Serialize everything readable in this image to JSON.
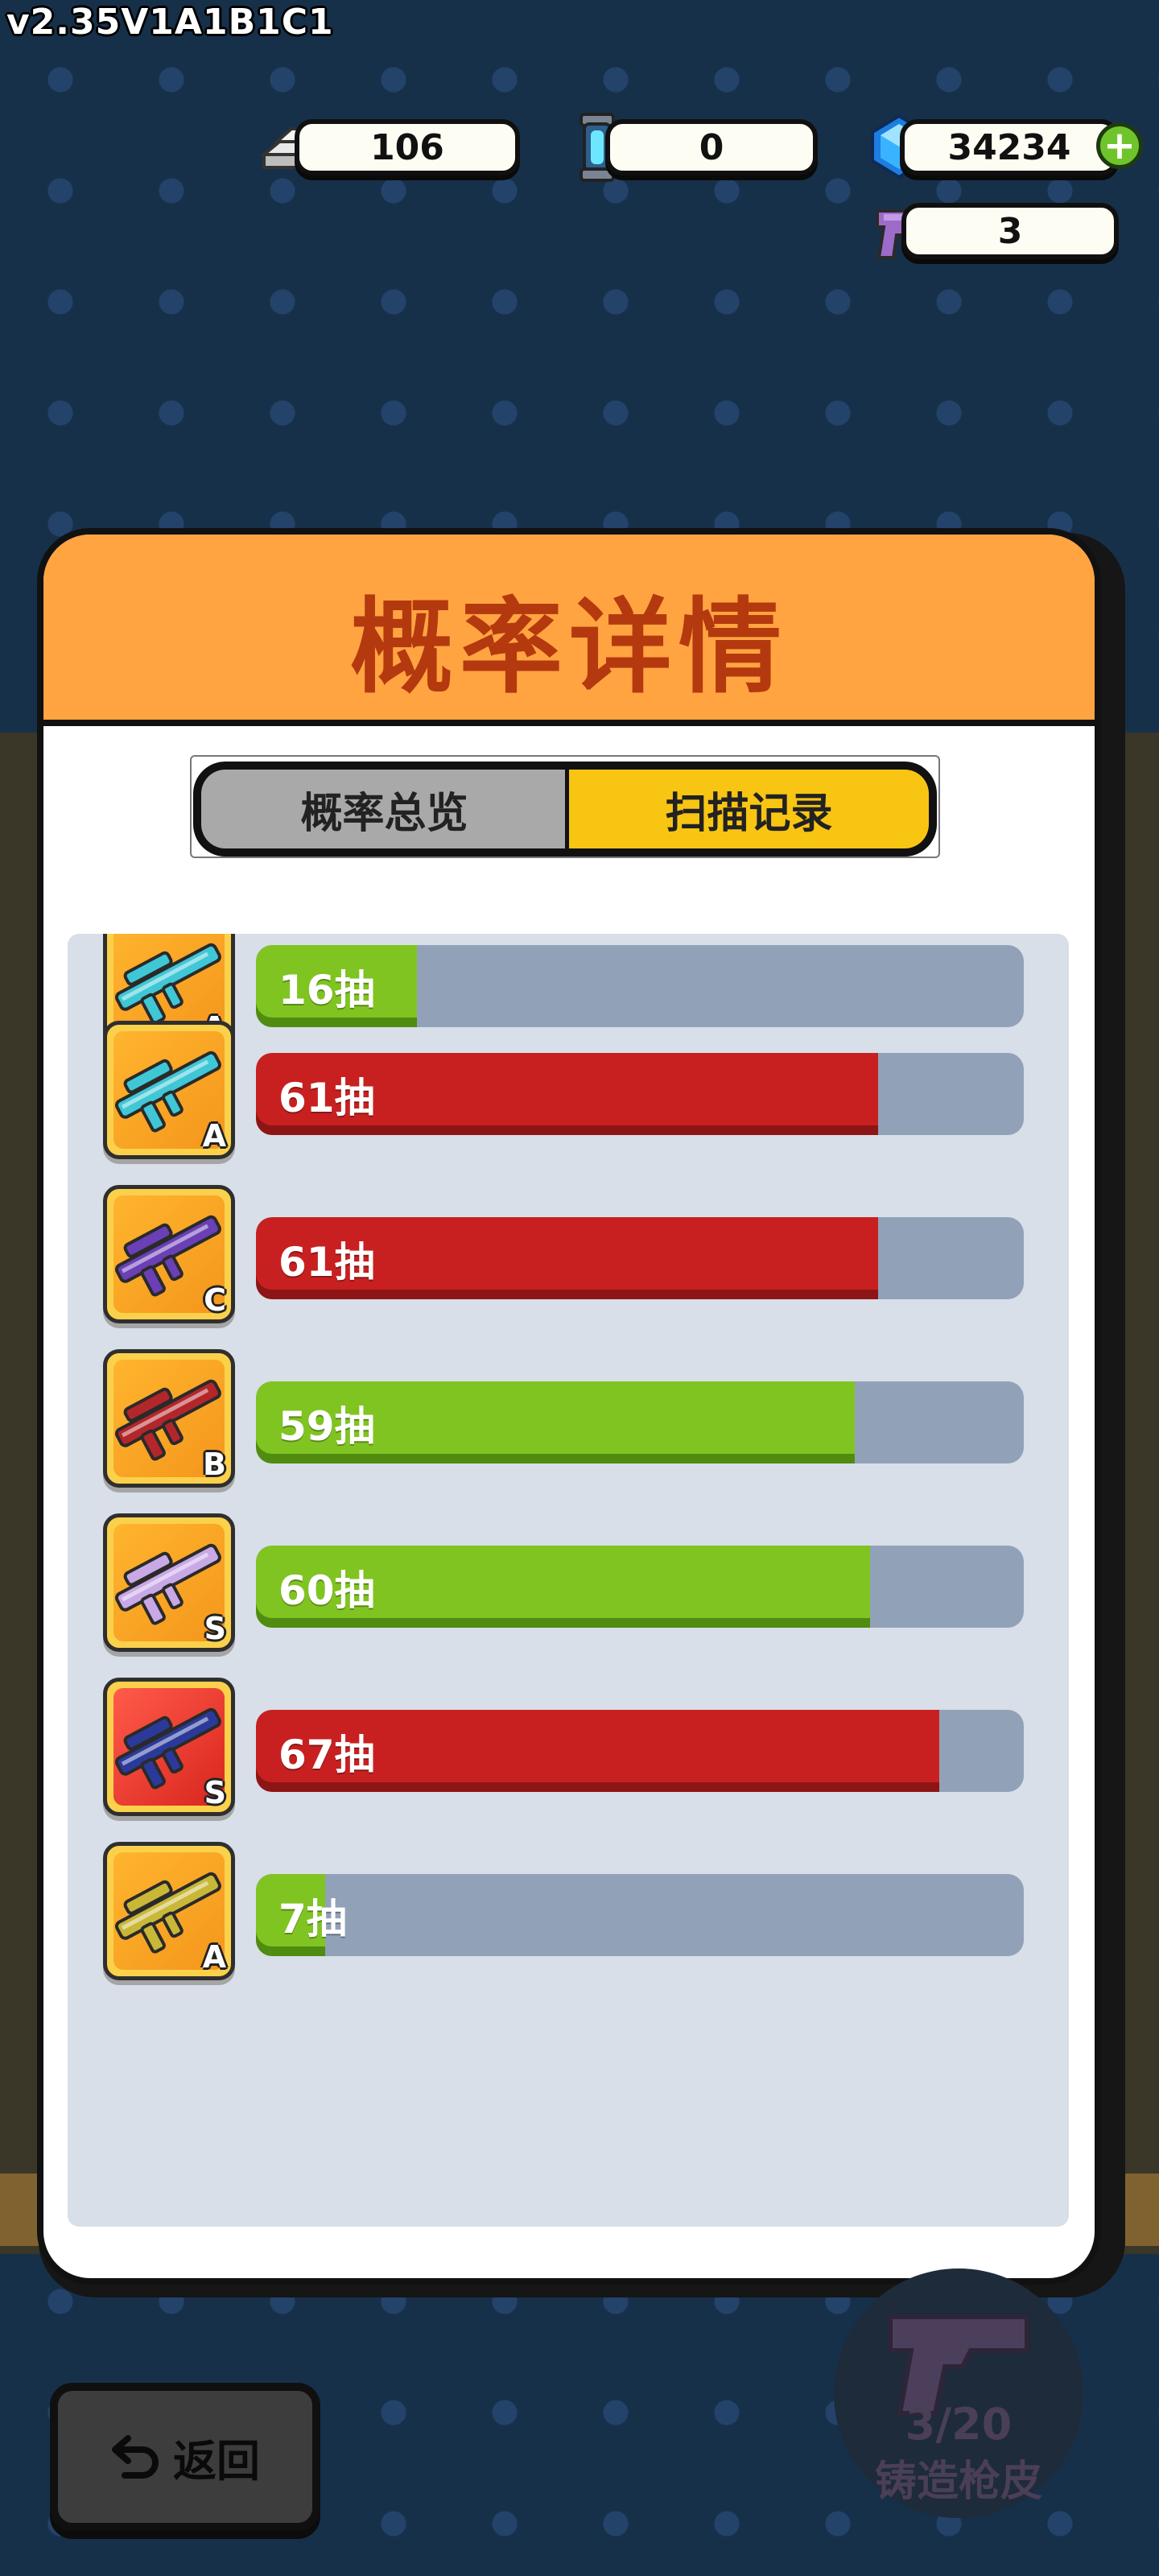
{
  "version": "v2.35V1A1B1C1",
  "resources": {
    "silver": "106",
    "crystal_tube": "0",
    "gems": "34234",
    "pistols": "3"
  },
  "dialog": {
    "title": "概率详情",
    "tabs": [
      {
        "label": "概率总览",
        "active": false
      },
      {
        "label": "扫描记录",
        "active": true
      }
    ],
    "rows": [
      {
        "label": "16抽",
        "grade": "A",
        "fill_fraction": 0.21,
        "bar_color": "green",
        "gun_color": "#3fc7d6"
      },
      {
        "label": "61抽",
        "grade": "A",
        "fill_fraction": 0.81,
        "bar_color": "red",
        "gun_color": "#3fc7d6"
      },
      {
        "label": "61抽",
        "grade": "C",
        "fill_fraction": 0.81,
        "bar_color": "red",
        "gun_color": "#6b3fb6"
      },
      {
        "label": "59抽",
        "grade": "B",
        "fill_fraction": 0.78,
        "bar_color": "green",
        "gun_color": "#b3262a"
      },
      {
        "label": "60抽",
        "grade": "S",
        "fill_fraction": 0.8,
        "bar_color": "green",
        "gun_color": "#c9a8e6"
      },
      {
        "label": "67抽",
        "grade": "S",
        "fill_fraction": 0.89,
        "bar_color": "red",
        "gun_color": "#2b3a9a"
      },
      {
        "label": "7抽",
        "grade": "A",
        "fill_fraction": 0.09,
        "bar_color": "green",
        "gun_color": "#c9b838"
      }
    ]
  },
  "footer": {
    "back_label": "返回",
    "forge_count": "3/20",
    "forge_label": "铸造枪皮"
  },
  "colors": {
    "header": "#ffa441",
    "title": "#b4390f",
    "tab_active": "#f8c513",
    "tab_inactive": "#a9a9a9",
    "bar_red": "#c82020",
    "bar_green": "#80c421",
    "track": "#91a2b8"
  }
}
